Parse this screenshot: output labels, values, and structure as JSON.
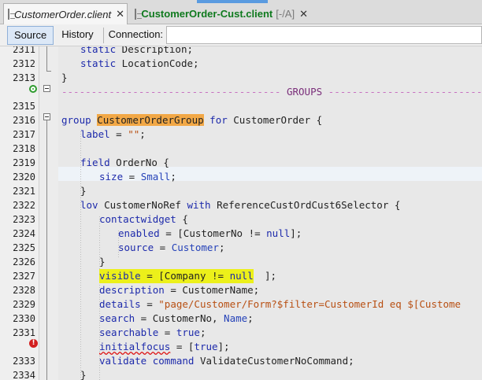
{
  "tabs": [
    {
      "title": "CustomerOrder.client",
      "close": "✕"
    },
    {
      "title": "CustomerOrder-Cust.client",
      "suffix": "[-/A]",
      "close": "✕"
    }
  ],
  "toolbar": {
    "source": "Source",
    "history": "History",
    "connection_label": "Connection:"
  },
  "line_numbers": [
    "2311",
    "2312",
    "2313",
    "",
    "2315",
    "2316",
    "2317",
    "2318",
    "2319",
    "2320",
    "2321",
    "2322",
    "2323",
    "2324",
    "2325",
    "2326",
    "2327",
    "2328",
    "2329",
    "2330",
    "2331",
    "",
    "2333",
    "2334"
  ],
  "code": {
    "l2311": {
      "kw": "static",
      "rest": " Description;"
    },
    "l2312": {
      "kw": "static",
      "rest": " LocationCode;"
    },
    "l2313": {
      "text": "}"
    },
    "l2314": {
      "dashes_left": "-------------------------------------",
      "label": " GROUPS ",
      "dashes_right": "----------------------------------"
    },
    "l2315": {
      "text": ""
    },
    "l2316": {
      "kw1": "group",
      "name": "CustomerOrderGroup",
      "kw2": "for",
      "rest": " CustomerOrder {"
    },
    "l2317": {
      "kw": "label",
      "eq": " = ",
      "str": "\"\"",
      "end": ";"
    },
    "l2318": {
      "text": ""
    },
    "l2319": {
      "kw": "field",
      "rest": " OrderNo {"
    },
    "l2320": {
      "kw": "size",
      "eq": " = ",
      "val": "Small",
      "end": ";"
    },
    "l2321": {
      "text": "}"
    },
    "l2322": {
      "kw1": "lov",
      "rest1": " CustomerNoRef ",
      "kw2": "with",
      "rest2": " ReferenceCustOrdCust6Selector {"
    },
    "l2323": {
      "kw": "contactwidget",
      "rest": " {"
    },
    "l2324": {
      "kw": "enabled",
      "eq": " = [CustomerNo != ",
      "kw2": "null",
      "end": "];"
    },
    "l2325": {
      "kw": "source",
      "eq": " = ",
      "val": "Customer",
      "end": ";"
    },
    "l2326": {
      "text": "}"
    },
    "l2327": {
      "kw": "visible",
      "eq": " = [Company != ",
      "kw2": "null",
      "end": "];"
    },
    "l2328": {
      "kw": "description",
      "eq": " = ",
      "val": "CustomerName;"
    },
    "l2329": {
      "kw": "details",
      "eq": " = ",
      "str": "\"page/Customer/Form?$filter=CustomerId eq $[Custome"
    },
    "l2330": {
      "kw": "search",
      "eq": " = ",
      "val": "CustomerNo, ",
      "val2": "Name",
      "end": ";"
    },
    "l2331": {
      "kw": "searchable",
      "eq": " = ",
      "kw2": "true",
      "end": ";"
    },
    "l2332": {
      "kw": "initialfocus",
      "eq": " = [",
      "kw2": "true",
      "end": "];"
    },
    "l2333": {
      "kw": "validate",
      "kw2": " command",
      "rest": " ValidateCustomerNoCommand;"
    },
    "l2334": {
      "text": "}"
    }
  },
  "markers": {
    "error_icon": "!"
  },
  "colors": {
    "keyword": "#1d2aab",
    "string": "#b84f12",
    "group_highlight": "#f2a846",
    "line_highlight": "#ecf01a",
    "active_tab_title": "#0f7a1e"
  }
}
